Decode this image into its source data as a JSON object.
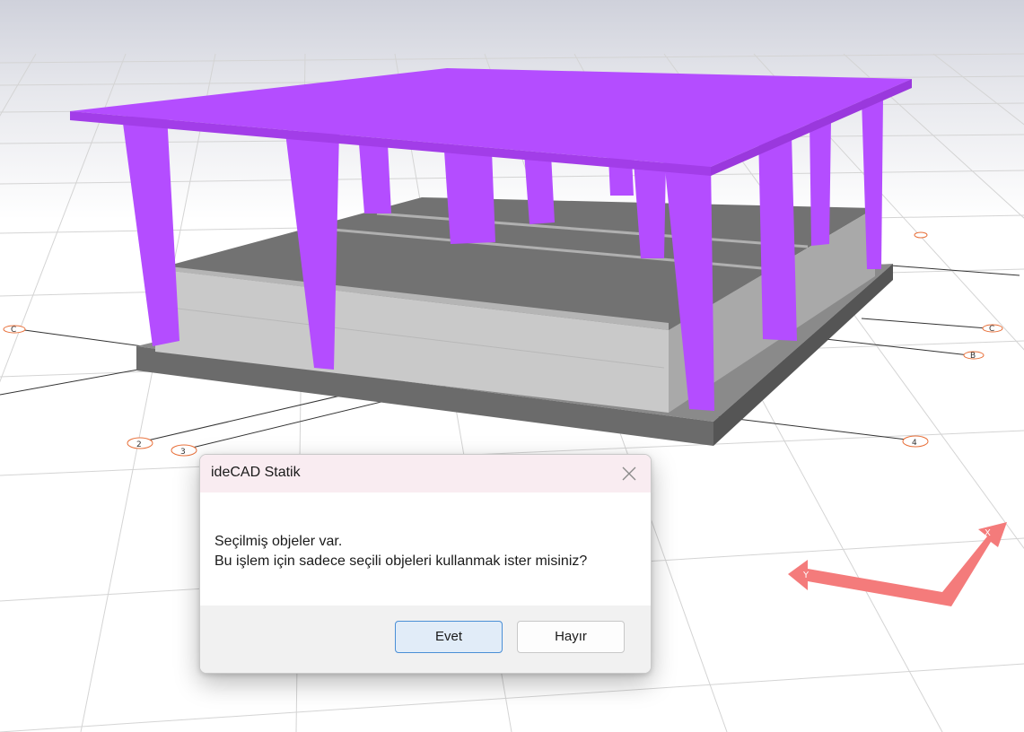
{
  "scene": {
    "viewport_name": "3D model view",
    "axis_labels": {
      "left_row": "C",
      "row_c": "C",
      "row_b": "B",
      "col_2": "2",
      "col_3": "3",
      "col_4": "4",
      "top_right": "C"
    },
    "gizmo": {
      "x_label": "X",
      "y_label": "Y",
      "color": "#f47b7b"
    },
    "colors": {
      "columns_slab": "#b44dff",
      "concrete": "#c9c9c9",
      "foundation": "#707070",
      "slab_top": "#7a7a7a"
    }
  },
  "dialog": {
    "title": "ideCAD Statik",
    "message_line1": "Seçilmiş objeler var.",
    "message_line2": "Bu işlem için sadece seçili objeleri kullanmak ister misiniz?",
    "yes_button": "Evet",
    "no_button": "Hayır"
  }
}
